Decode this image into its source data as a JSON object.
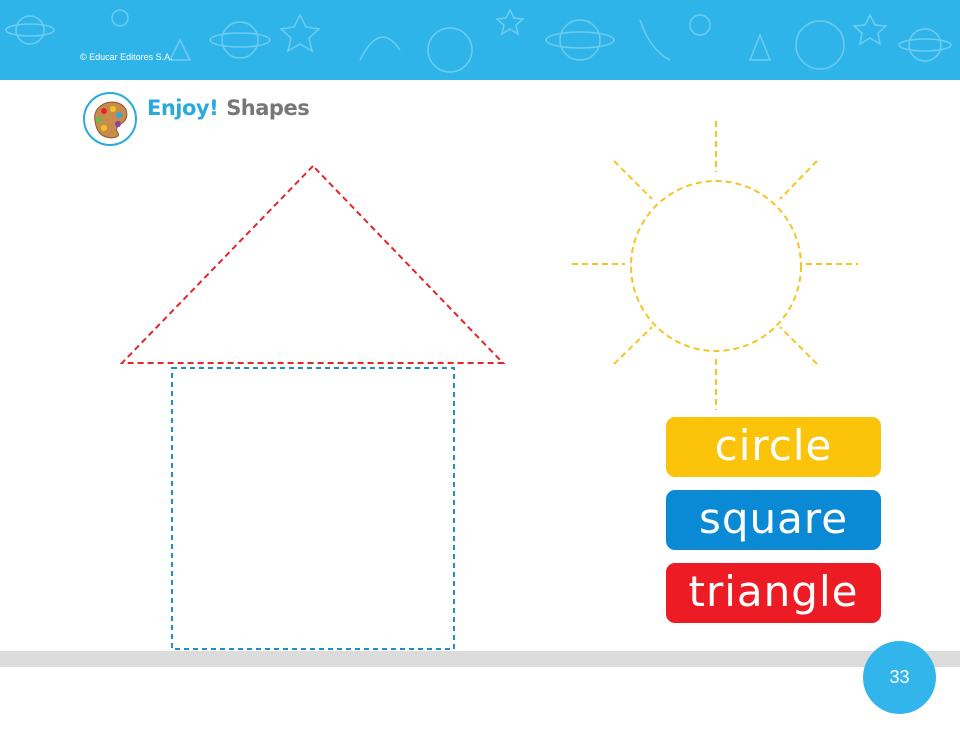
{
  "header": {
    "copyright": "© Educar Editores S.A.",
    "band_color": "#2fb4ea"
  },
  "title": {
    "enjoy": "Enjoy!",
    "topic": "Shapes",
    "icon": "paint-palette-icon"
  },
  "drawings": {
    "roof_triangle_color": "#e2262b",
    "house_square_color": "#1f8fc9",
    "sun_circle_color": "#f4c524"
  },
  "labels": [
    {
      "text": "circle",
      "color": "#fbc40a"
    },
    {
      "text": "square",
      "color": "#0a8ad4"
    },
    {
      "text": "triangle",
      "color": "#ed1c24"
    }
  ],
  "page": {
    "number": "33"
  }
}
